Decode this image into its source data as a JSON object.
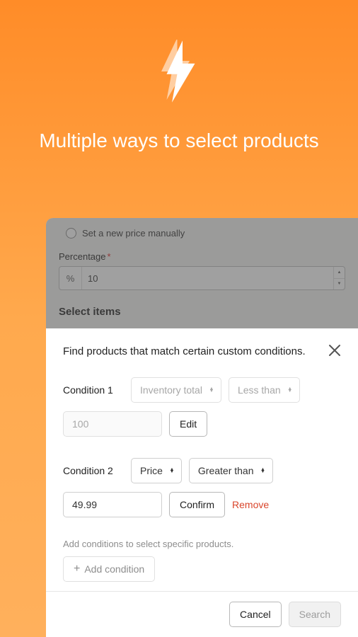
{
  "hero": {
    "title": "Multiple ways to select products"
  },
  "background": {
    "radio_label": "Set a new price manually",
    "percentage_label": "Percentage",
    "percentage_prefix": "%",
    "percentage_value": "10",
    "section_title": "Select items"
  },
  "modal": {
    "title": "Find products that match certain custom conditions.",
    "conditions": [
      {
        "label": "Condition 1",
        "field": "Inventory total",
        "operator": "Less than",
        "value": "100",
        "action": "Edit",
        "disabled": true
      },
      {
        "label": "Condition 2",
        "field": "Price",
        "operator": "Greater than",
        "value": "49.99",
        "action": "Confirm",
        "remove": "Remove",
        "disabled": false
      }
    ],
    "help_text": "Add conditions to select specific products.",
    "add_condition": "Add condition",
    "cancel": "Cancel",
    "search": "Search"
  }
}
